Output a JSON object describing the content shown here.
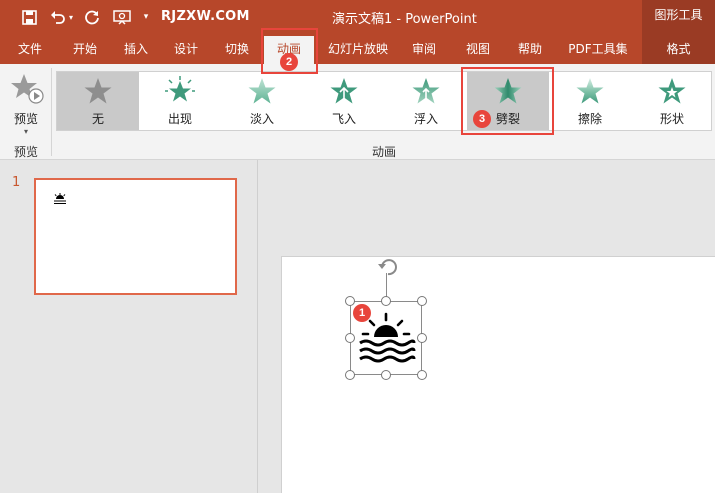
{
  "titlebar": {
    "site": "RJZXW.COM",
    "doc_title": "演示文稿1 - PowerPoint",
    "tool_tab": "图形工具"
  },
  "tabs": [
    {
      "label": "文件",
      "name": "tab-file"
    },
    {
      "label": "开始",
      "name": "tab-home"
    },
    {
      "label": "插入",
      "name": "tab-insert"
    },
    {
      "label": "设计",
      "name": "tab-design"
    },
    {
      "label": "切换",
      "name": "tab-transitions"
    },
    {
      "label": "动画",
      "name": "tab-animations"
    },
    {
      "label": "幻灯片放映",
      "name": "tab-slideshow"
    },
    {
      "label": "审阅",
      "name": "tab-review"
    },
    {
      "label": "视图",
      "name": "tab-view"
    },
    {
      "label": "帮助",
      "name": "tab-help"
    },
    {
      "label": "PDF工具集",
      "name": "tab-pdf-tools"
    },
    {
      "label": "格式",
      "name": "tab-format"
    }
  ],
  "ribbon": {
    "preview_label": "预览",
    "preview_group": "预览",
    "animation_group": "动画",
    "effects": [
      {
        "label": "无",
        "icon": "none-star-icon"
      },
      {
        "label": "出现",
        "icon": "appear-star-icon"
      },
      {
        "label": "淡入",
        "icon": "fade-star-icon"
      },
      {
        "label": "飞入",
        "icon": "fly-in-star-icon"
      },
      {
        "label": "浮入",
        "icon": "float-in-star-icon"
      },
      {
        "label": "劈裂",
        "icon": "split-star-icon"
      },
      {
        "label": "擦除",
        "icon": "wipe-star-icon"
      },
      {
        "label": "形状",
        "icon": "shape-star-icon"
      }
    ]
  },
  "slide_panel": {
    "slide_number": "1"
  },
  "annotations": [
    "1",
    "2",
    "3"
  ],
  "colors": {
    "ribbon_bar": "#b7472a",
    "star_green": "#3f9a7c",
    "annotation_red": "#e8453c",
    "thumb_border": "#e0684a"
  }
}
